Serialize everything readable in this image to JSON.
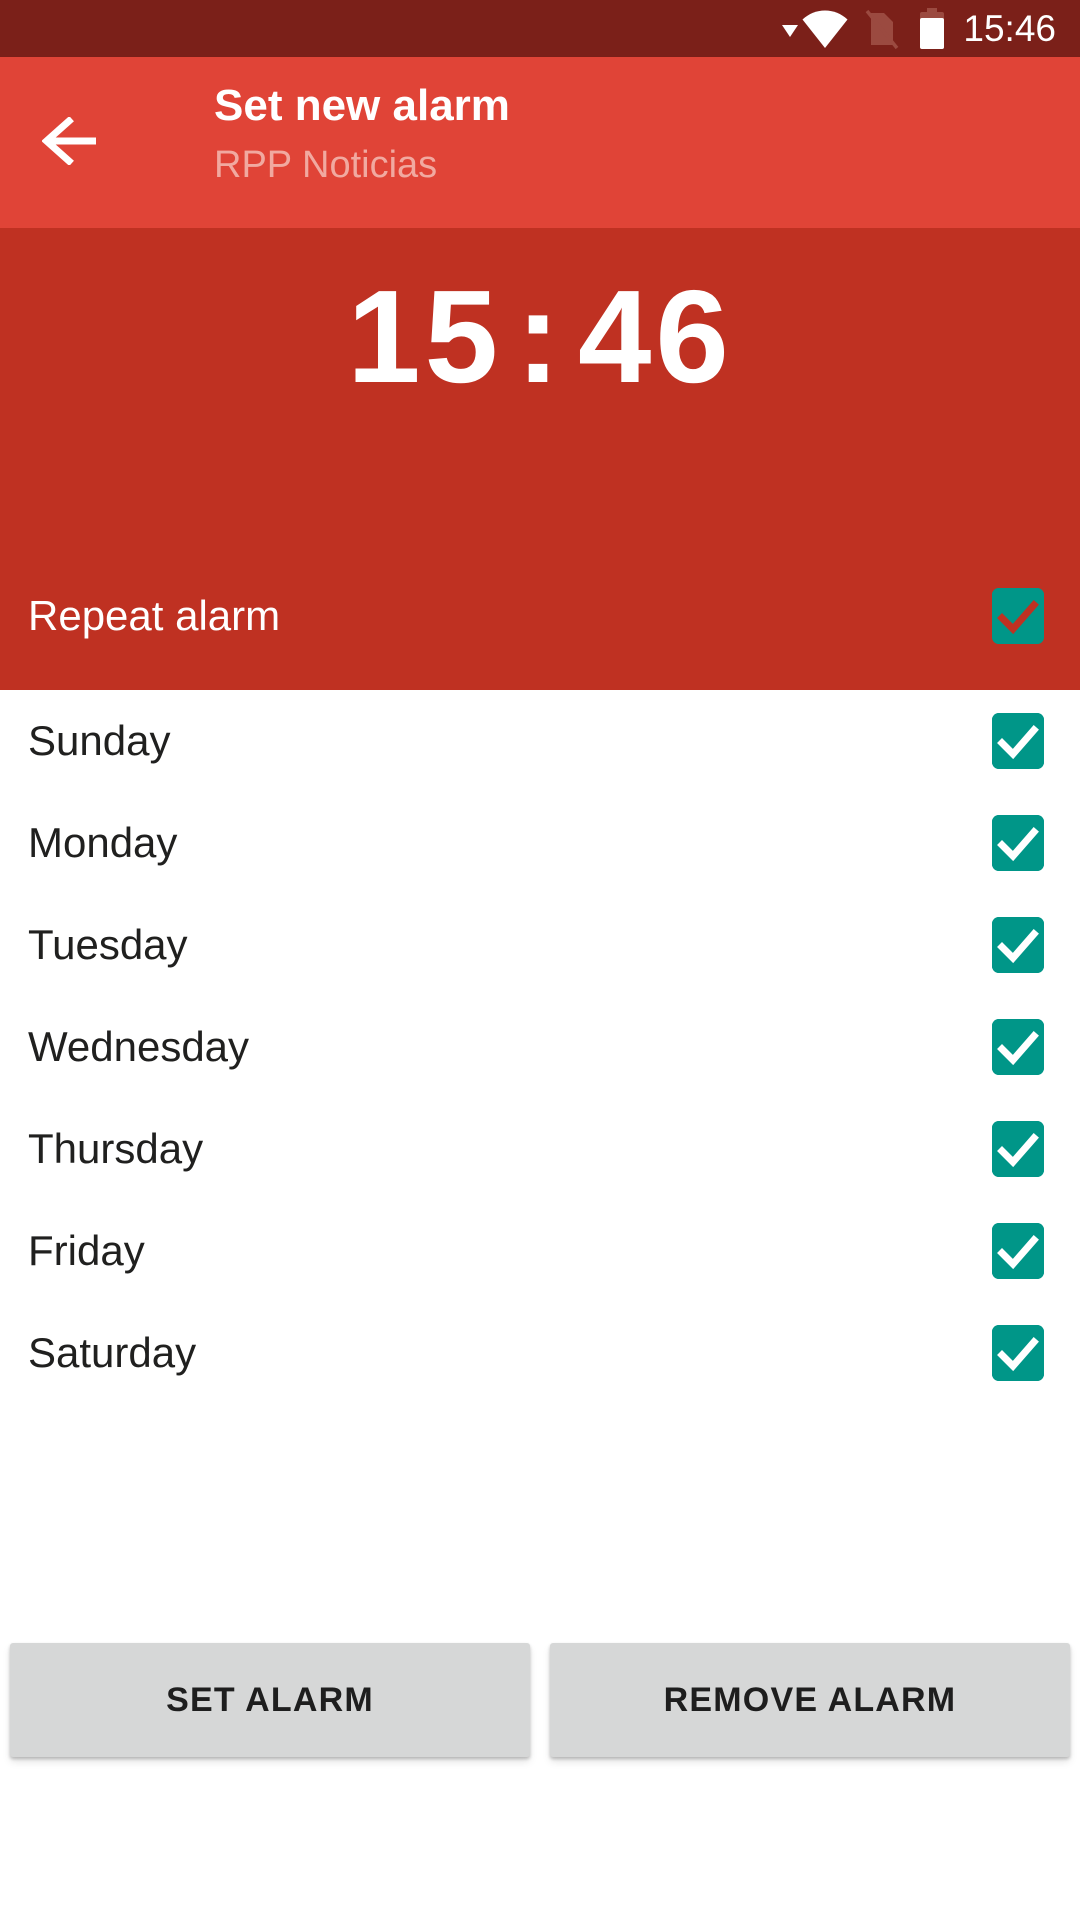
{
  "status_bar": {
    "time": "15:46",
    "icons": [
      "dropdown-triangle-icon",
      "wifi-icon",
      "sim-card-off-icon",
      "battery-icon"
    ],
    "background_color": "#7B2019"
  },
  "toolbar": {
    "back_label": "back-arrow-icon",
    "title": "Set new alarm",
    "subtitle": "RPP Noticias",
    "background_color": "#E04437",
    "subtitle_color": "#F1A9A0"
  },
  "alarm": {
    "hour": "15",
    "separator": ":",
    "minute": "46",
    "background_color": "#BF3122",
    "repeat": {
      "label": "Repeat alarm",
      "checked": true
    }
  },
  "days": [
    {
      "label": "Sunday",
      "checked": true
    },
    {
      "label": "Monday",
      "checked": true
    },
    {
      "label": "Tuesday",
      "checked": true
    },
    {
      "label": "Wednesday",
      "checked": true
    },
    {
      "label": "Thursday",
      "checked": true
    },
    {
      "label": "Friday",
      "checked": true
    },
    {
      "label": "Saturday",
      "checked": true
    }
  ],
  "checkbox_color": "#009688",
  "actions": {
    "set_alarm_label": "SET ALARM",
    "remove_alarm_label": "REMOVE ALARM",
    "button_color": "#D6D7D7"
  }
}
